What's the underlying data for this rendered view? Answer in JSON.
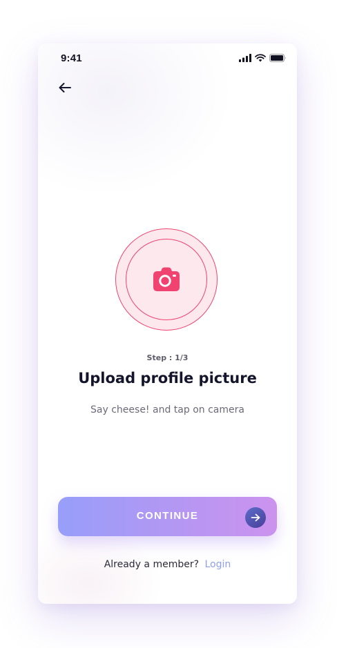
{
  "status_bar": {
    "time": "9:41",
    "icons": [
      "cellular-signal-icon",
      "wifi-icon",
      "battery-icon"
    ]
  },
  "navigation": {
    "back_icon": "arrow-left-icon"
  },
  "upload": {
    "icon": "camera-icon",
    "accent_color": "#f0436f",
    "circle_fill": "#fde8ee"
  },
  "content": {
    "step": "Step : 1/3",
    "title": "Upload profile picture",
    "subtitle": "Say cheese! and tap on camera"
  },
  "continue_button": {
    "label": "CONTINUE",
    "icon": "arrow-right-icon",
    "gradient": [
      "#979ef9",
      "#cc93ee"
    ]
  },
  "footer": {
    "prompt": "Already a member?",
    "login_label": "Login",
    "login_color": "#8fa0ea"
  }
}
